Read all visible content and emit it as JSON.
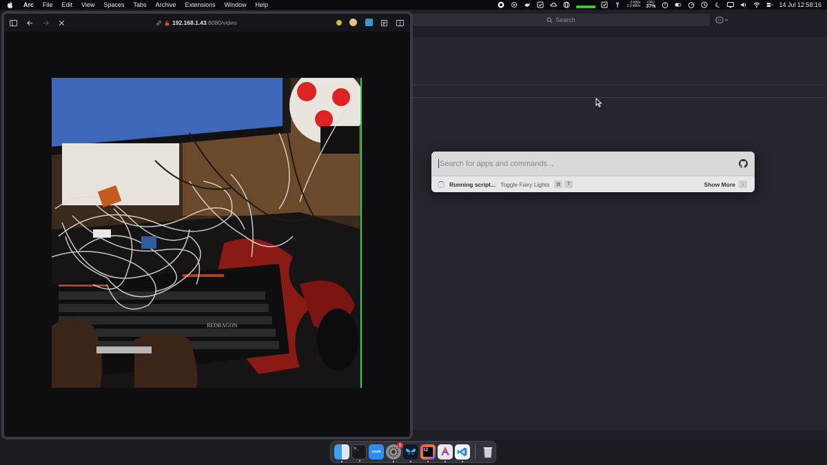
{
  "menubar": {
    "app_name": "Arc",
    "items": [
      "File",
      "Edit",
      "View",
      "Spaces",
      "Tabs",
      "Archive",
      "Extensions",
      "Window",
      "Help"
    ],
    "net_up": "0 KB/s",
    "net_down": "3.9 MB/s",
    "cpu_label": "CPU",
    "cpu_value": "37%",
    "datetime": "14 Jul  12:58:16"
  },
  "browser": {
    "url_host": "192.168.1.43",
    "url_path": ":8080/video"
  },
  "background_app": {
    "search_label": "Search"
  },
  "palette": {
    "placeholder": "Search for apps and commands...",
    "status": "Running script...",
    "command": "Toggle Fairy Lights",
    "shortcut_mod": "⌘",
    "shortcut_key": "T",
    "show_more": "Show More",
    "show_more_key": "↓"
  },
  "dock": {
    "zoom_label": "zoom",
    "badge": "1"
  },
  "video": {
    "keyboard_brand": "REDRAGON"
  }
}
